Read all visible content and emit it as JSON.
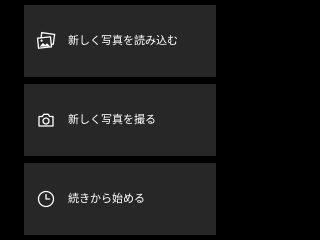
{
  "menu": {
    "items": [
      {
        "label": "新しく写真を読み込む",
        "icon": "photo-library-icon"
      },
      {
        "label": "新しく写真を撮る",
        "icon": "camera-icon"
      },
      {
        "label": "続きから始める",
        "icon": "clock-icon"
      }
    ]
  },
  "colors": {
    "background": "#000000",
    "card": "#272727",
    "text": "#ffffff"
  }
}
